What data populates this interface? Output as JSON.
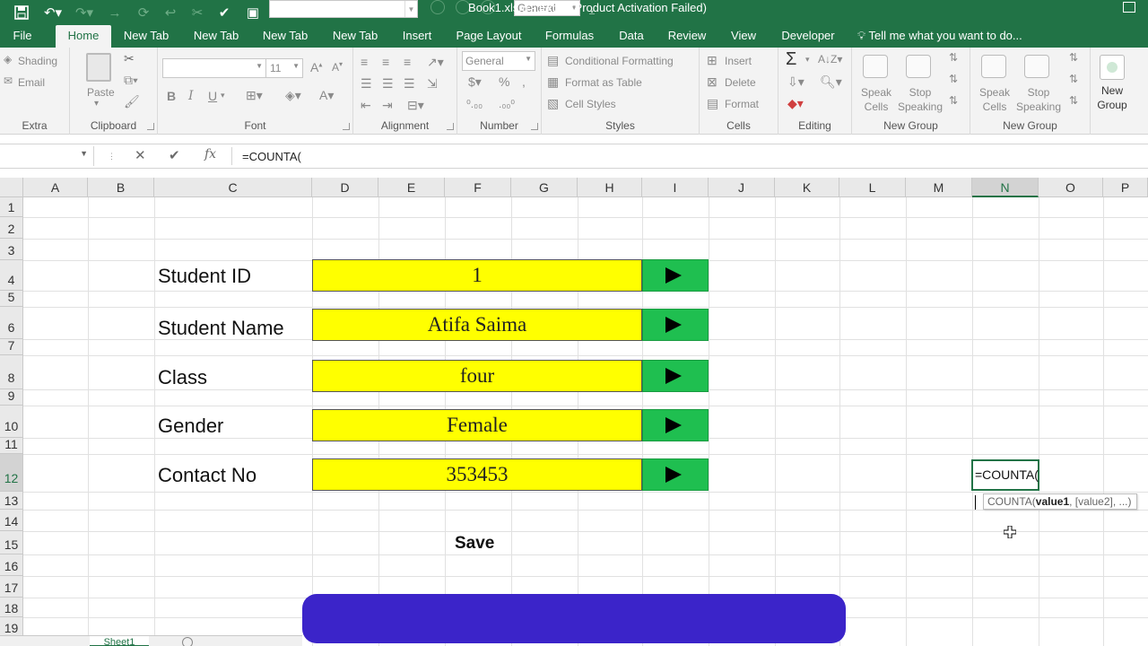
{
  "window": {
    "title": "Book1.xlsm - Excel (Product Activation Failed)",
    "number_format_top": "General"
  },
  "tabs": [
    "File",
    "Home",
    "New Tab",
    "New Tab",
    "New Tab",
    "New Tab",
    "Insert",
    "Page Layout",
    "Formulas",
    "Data",
    "Review",
    "View",
    "Developer"
  ],
  "tell_me": "Tell me what you want to do...",
  "ribbon": {
    "extra": {
      "shading": "Shading",
      "email": "Email",
      "label": "Extra"
    },
    "clipboard": {
      "paste": "Paste",
      "label": "Clipboard"
    },
    "font": {
      "size": "11",
      "label": "Font"
    },
    "alignment": {
      "label": "Alignment"
    },
    "number": {
      "format": "General",
      "label": "Number"
    },
    "styles": {
      "conditional": "Conditional Formatting",
      "format_table": "Format as Table",
      "cell_styles": "Cell Styles",
      "label": "Styles"
    },
    "cells": {
      "insert": "Insert",
      "delete": "Delete",
      "format": "Format",
      "label": "Cells"
    },
    "editing": {
      "label": "Editing"
    },
    "new_group_1": {
      "speak_cells": "Speak Cells",
      "stop_speaking": "Stop Speaking",
      "label": "New Group"
    },
    "new_group_2": {
      "speak_cells": "Speak Cells",
      "stop_speaking": "Stop Speaking",
      "label": "New Group"
    },
    "new_group_btn": "New Group"
  },
  "formula_bar": {
    "formula": "=COUNTA("
  },
  "columns": [
    "A",
    "B",
    "C",
    "D",
    "E",
    "F",
    "G",
    "H",
    "I",
    "J",
    "K",
    "L",
    "M",
    "N",
    "O",
    "P"
  ],
  "rows": [
    "1",
    "2",
    "3",
    "4",
    "5",
    "6",
    "7",
    "8",
    "9",
    "10",
    "11",
    "12",
    "13",
    "14",
    "15",
    "16",
    "17",
    "18",
    "19"
  ],
  "form": {
    "fields": [
      {
        "label": "Student ID",
        "value": "1"
      },
      {
        "label": "Student Name",
        "value": "Atifa Saima"
      },
      {
        "label": "Class",
        "value": "four"
      },
      {
        "label": "Gender",
        "value": "Female"
      },
      {
        "label": "Contact No",
        "value": "353453"
      }
    ],
    "save_label": "Save"
  },
  "active_cell": {
    "value": "=COUNTA("
  },
  "tooltip": {
    "fn": "COUNTA(",
    "arg1": "value1",
    "rest": ", [value2], ...)"
  },
  "sheet_tab": "Sheet1",
  "colors": {
    "excel_green": "#217346",
    "form_yellow": "#ffff00",
    "arrow_green": "#1fbf50",
    "overlay_blue": "#3b24c9"
  }
}
